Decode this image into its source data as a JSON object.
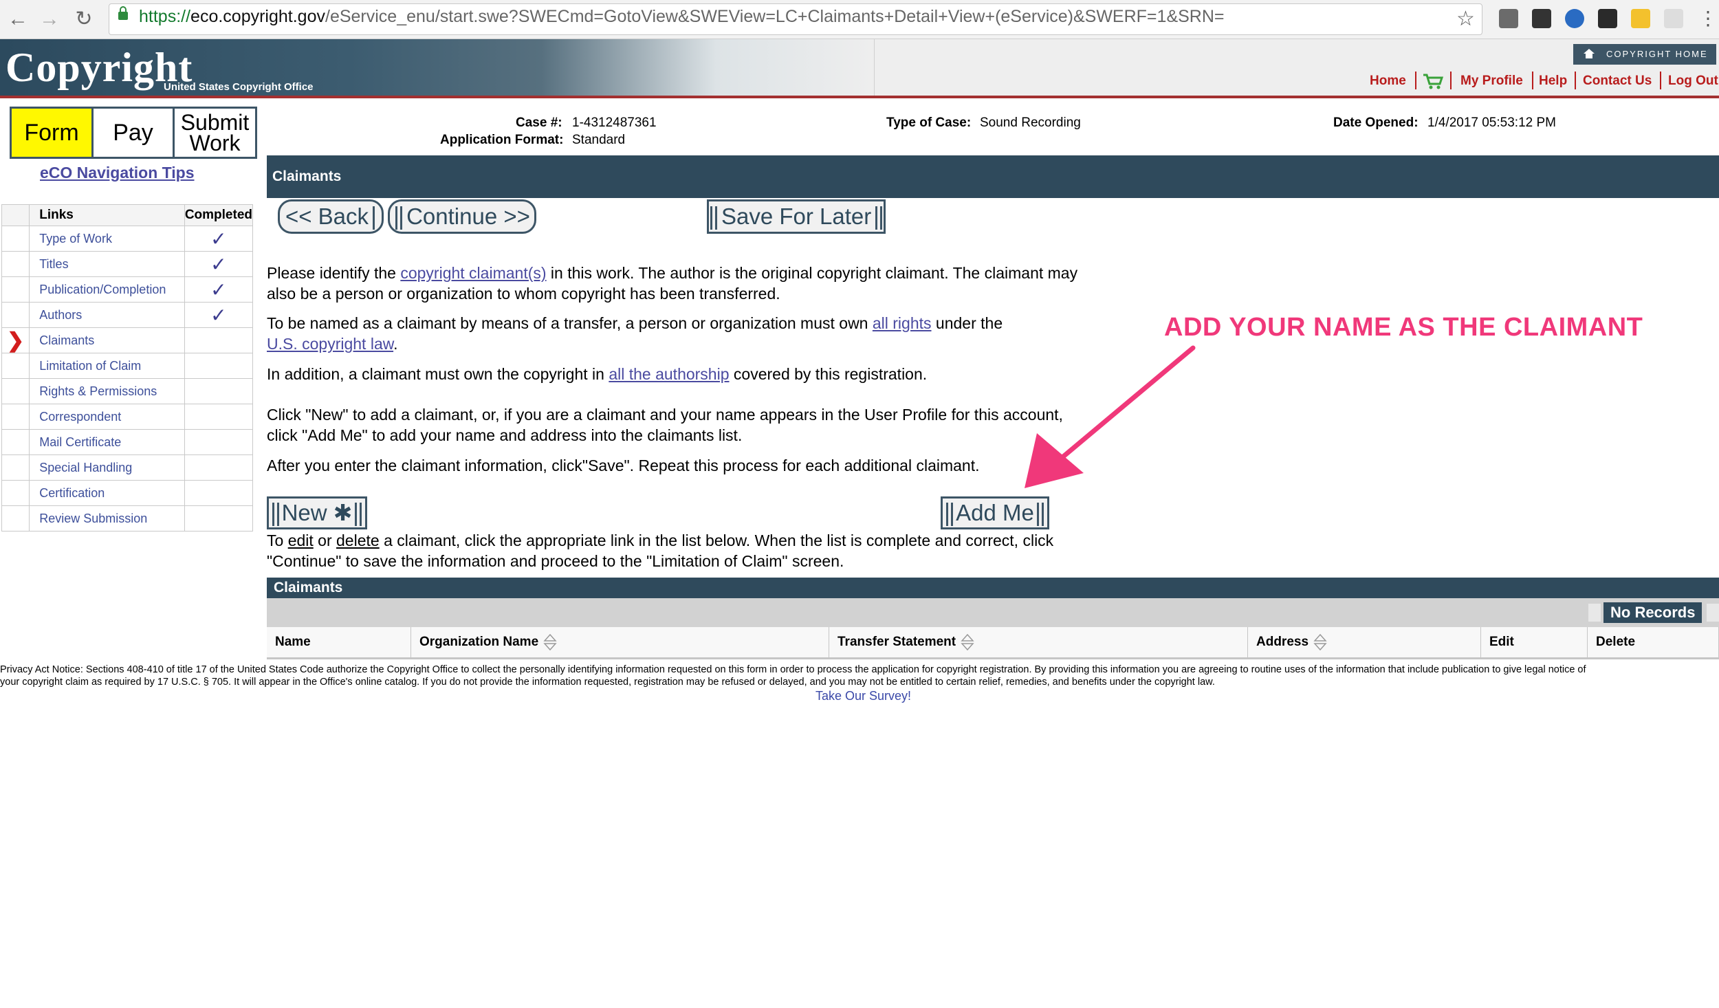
{
  "browser": {
    "url_proto": "https://",
    "url_host": "eco.copyright.gov",
    "url_path": "/eService_enu/start.swe?SWECmd=GotoView&SWEView=LC+Claimants+Detail+View+(eService)&SWERF=1&SRN=",
    "back_icon": "back-arrow-icon",
    "forward_icon": "forward-arrow-icon",
    "reload_icon": "reload-icon",
    "star_icon": "star-icon"
  },
  "header": {
    "logo_text": "Copyright",
    "logo_sub": "United States Copyright Office",
    "copyright_home": "COPYRIGHT HOME",
    "links": [
      "Home",
      "My Profile",
      "Help",
      "Contact Us",
      "Log Out"
    ]
  },
  "tabs": {
    "form": "Form",
    "pay": "Pay",
    "submit_line1": "Submit",
    "submit_line2": "Work"
  },
  "nav_tips": "eCO Navigation Tips",
  "links_table": {
    "col_links": "Links",
    "col_completed": "Completed",
    "items": [
      {
        "label": "Type of Work",
        "completed": "✓"
      },
      {
        "label": "Titles",
        "completed": "✓"
      },
      {
        "label": "Publication/Completion",
        "completed": "✓"
      },
      {
        "label": "Authors",
        "completed": "✓"
      },
      {
        "label": "Claimants",
        "completed": ""
      },
      {
        "label": "Limitation of Claim",
        "completed": ""
      },
      {
        "label": "Rights & Permissions",
        "completed": ""
      },
      {
        "label": "Correspondent",
        "completed": ""
      },
      {
        "label": "Mail Certificate",
        "completed": ""
      },
      {
        "label": "Special Handling",
        "completed": ""
      },
      {
        "label": "Certification",
        "completed": ""
      },
      {
        "label": "Review Submission",
        "completed": ""
      }
    ],
    "current_marker": "❯"
  },
  "case_info": {
    "case_label": "Case #:",
    "case_value": "1-4312487361",
    "format_label": "Application Format:",
    "format_value": "Standard",
    "type_label": "Type of Case:",
    "type_value": "Sound Recording",
    "opened_label": "Date Opened:",
    "opened_value": "1/4/2017 05:53:12 PM"
  },
  "section_title": "Claimants",
  "buttons": {
    "back": "<< Back",
    "continue": "Continue >>",
    "save_later": "Save For Later",
    "new": "New ✱",
    "add_me": "Add Me"
  },
  "paragraphs": {
    "p1_a": "Please identify the ",
    "p1_link": "copyright claimant(s)",
    "p1_b": " in this work. The author is the original copyright claimant. The claimant may",
    "p1_c": "also be a person or organization to whom copyright has been transferred.",
    "p2_a": "To be named as a claimant by means of a transfer, a person or organization must own ",
    "p2_link1": "all rights",
    "p2_b": " under the",
    "p2_link2": "U.S. copyright law",
    "p2_c": ".",
    "p3_a": "In addition, a claimant must own the copyright in ",
    "p3_link": "all the authorship",
    "p3_b": " covered by this registration.",
    "p4_a": "Click \"New\" to add a claimant, or, if you are a claimant and your name appears in the User Profile for this account,",
    "p4_b": "click \"Add Me\" to add your name and address into the claimants list.",
    "p5": "After you enter the claimant information, click\"Save\". Repeat this process for each additional claimant.",
    "p6_a": "To ",
    "p6_edit": "edit",
    "p6_or": " or ",
    "p6_delete": "delete",
    "p6_b": " a claimant, click the appropriate link in the list below. When the list is complete and correct, click",
    "p6_c": "\"Continue\" to save the information and proceed to the \"Limitation of Claim\" screen."
  },
  "annotation": "ADD YOUR NAME AS THE CLAIMANT",
  "claimants_table": {
    "title": "Claimants",
    "no_records": "No Records",
    "columns": [
      "Name",
      "Organization Name",
      "Transfer Statement",
      "Address",
      "Edit",
      "Delete"
    ]
  },
  "privacy": {
    "line1": "Privacy Act Notice: Sections 408-410 of title 17 of the United States Code authorize the Copyright Office to collect the personally identifying information requested on this form in order to process the application for copyright registration. By providing this information you are agreeing to routine uses of the information that include publication to give legal notice of",
    "line2": "your copyright claim as required by 17 U.S.C. § 705. It will appear in the Office's online catalog. If you do not provide the information requested, registration may be refused or delayed, and you may not be entitled to certain relief, remedies, and benefits under the copyright law."
  },
  "survey": "Take Our Survey!",
  "colors": {
    "header_dark": "#2f4a5c",
    "link_red": "#b81c1c",
    "form_tab": "#fff800",
    "annotation": "#f0387a"
  }
}
